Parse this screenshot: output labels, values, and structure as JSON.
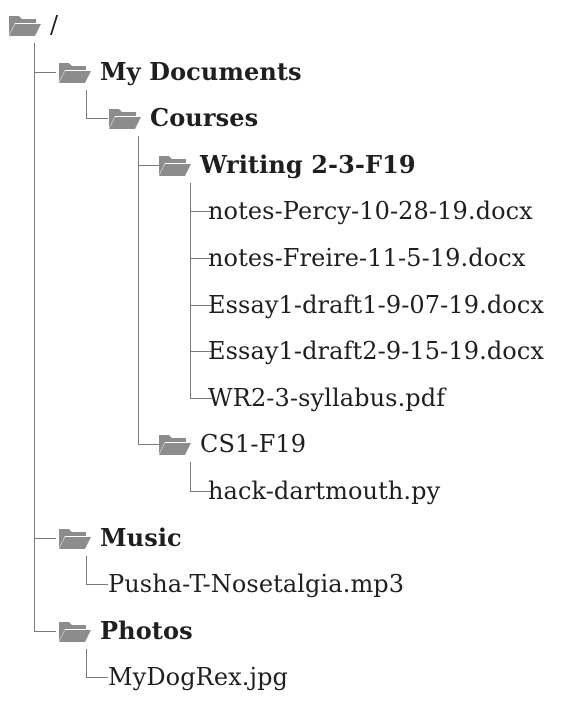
{
  "tree": {
    "nodes": [
      {
        "id": "root",
        "label": "/",
        "type": "folder",
        "depth": 0,
        "bold": false
      },
      {
        "id": "my-documents",
        "label": "My Documents",
        "type": "folder",
        "depth": 1,
        "bold": true
      },
      {
        "id": "courses",
        "label": "Courses",
        "type": "folder",
        "depth": 2,
        "bold": true
      },
      {
        "id": "writing",
        "label": "Writing 2-3-F19",
        "type": "folder",
        "depth": 3,
        "bold": true
      },
      {
        "id": "notes-percy",
        "label": "notes-Percy-10-28-19.docx",
        "type": "file",
        "depth": 4,
        "bold": false
      },
      {
        "id": "notes-freire",
        "label": "notes-Freire-11-5-19.docx",
        "type": "file",
        "depth": 4,
        "bold": false
      },
      {
        "id": "essay1-draft1",
        "label": "Essay1-draft1-9-07-19.docx",
        "type": "file",
        "depth": 4,
        "bold": false
      },
      {
        "id": "essay1-draft2",
        "label": "Essay1-draft2-9-15-19.docx",
        "type": "file",
        "depth": 4,
        "bold": false
      },
      {
        "id": "syllabus",
        "label": "WR2-3-syllabus.pdf",
        "type": "file",
        "depth": 4,
        "bold": false
      },
      {
        "id": "cs1",
        "label": "CS1-F19",
        "type": "folder",
        "depth": 3,
        "bold": false
      },
      {
        "id": "hack-dartmouth",
        "label": "hack-dartmouth.py",
        "type": "file",
        "depth": 4,
        "bold": false
      },
      {
        "id": "music",
        "label": "Music",
        "type": "folder",
        "depth": 1,
        "bold": true
      },
      {
        "id": "pusha-t",
        "label": "Pusha-T-Nosetalgia.mp3",
        "type": "file",
        "depth": 2,
        "bold": false
      },
      {
        "id": "photos",
        "label": "Photos",
        "type": "folder",
        "depth": 1,
        "bold": true
      },
      {
        "id": "mydogrex",
        "label": "MyDogRex.jpg",
        "type": "file",
        "depth": 2,
        "bold": false
      }
    ],
    "folder_icon": "folder-open-icon",
    "colors": {
      "folder": "#8c8c8c",
      "connector": "#7a7a7a",
      "text": "#1f1f1f"
    }
  }
}
